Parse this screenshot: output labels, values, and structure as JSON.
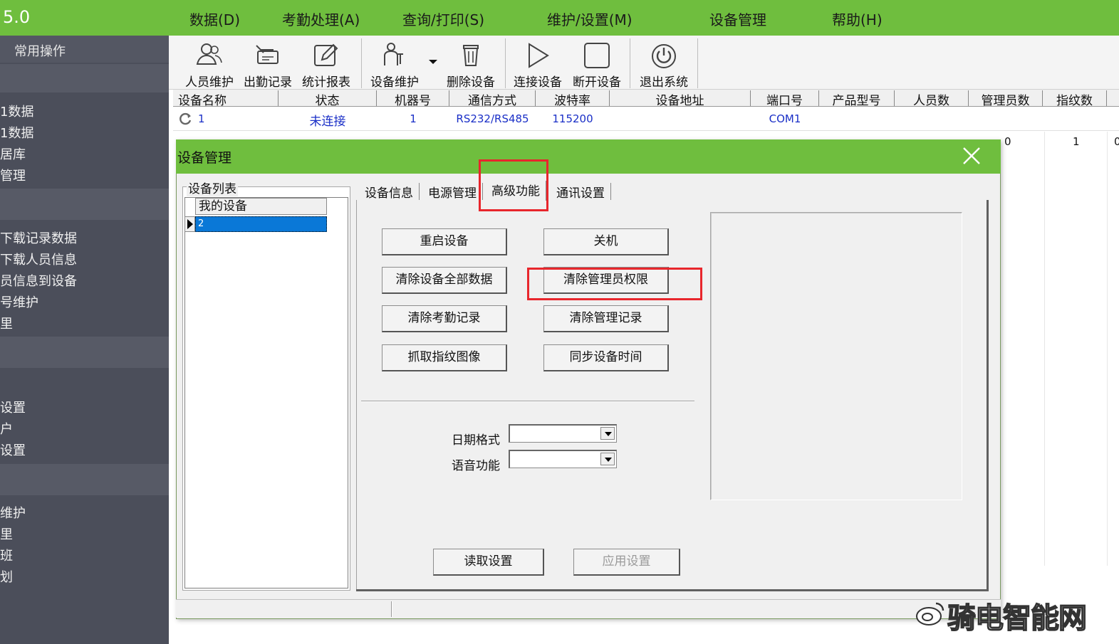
{
  "app": {
    "version": "5.0"
  },
  "menu": [
    "数据(D)",
    "考勤处理(A)",
    "查询/打印(S)",
    "维护/设置(M)",
    "设备管理",
    "帮助(H)"
  ],
  "sidebar": {
    "header": "常用操作",
    "items": [
      "1数据",
      "1数据",
      "居库",
      "管理",
      "下载记录数据",
      "下载人员信息",
      "员信息到设备",
      "号维护",
      "里",
      "设置",
      "户",
      "设置",
      "维护",
      "里",
      "班",
      "划"
    ]
  },
  "toolbar": {
    "tools": [
      {
        "label": "人员维护",
        "icon": "people-icon"
      },
      {
        "label": "出勤记录",
        "icon": "attendance-card-icon"
      },
      {
        "label": "统计报表",
        "icon": "edit-report-icon"
      },
      {
        "label": "设备维护",
        "icon": "device-maintenance-icon"
      },
      {
        "label": "删除设备",
        "icon": "trash-icon"
      },
      {
        "label": "连接设备",
        "icon": "play-icon"
      },
      {
        "label": "断开设备",
        "icon": "stop-icon"
      },
      {
        "label": "退出系统",
        "icon": "power-icon"
      }
    ]
  },
  "device_grid": {
    "columns": [
      "设备名称",
      "状态",
      "机器号",
      "通信方式",
      "波特率",
      "设备地址",
      "端口号",
      "产品型号",
      "人员数",
      "管理员数",
      "指纹数"
    ],
    "rows": [
      {
        "name": "1",
        "status": "未连接",
        "machine_no": "1",
        "comm": "RS232/RS485",
        "baud": "115200",
        "address": "",
        "port": "COM1"
      }
    ],
    "background_values": [
      "0",
      "1",
      "0"
    ]
  },
  "dialog": {
    "title": "设备管理",
    "device_list": {
      "caption": "设备列表",
      "column_header": "我的设备",
      "selected_item": "2"
    },
    "tabs": [
      "设备信息",
      "电源管理",
      "高级功能",
      "通讯设置"
    ],
    "active_tab": "高级功能",
    "buttons": {
      "restart": "重启设备",
      "shutdown": "关机",
      "clear_all": "清除设备全部数据",
      "clear_admin": "清除管理员权限",
      "clear_attendance": "清除考勤记录",
      "clear_admin_log": "清除管理记录",
      "capture_fp": "抓取指纹图像",
      "sync_time": "同步设备时间",
      "read_settings": "读取设置",
      "apply_settings": "应用设置"
    },
    "fields": {
      "date_format_label": "日期格式",
      "date_format_value": "",
      "voice_label": "语音功能",
      "voice_value": ""
    },
    "highlight_color": "#e8262c"
  },
  "watermark": "骑电智能网",
  "colors": {
    "accent": "#6fbe3e",
    "sidebar": "#4b4e5a",
    "selection": "#0a78d7"
  }
}
